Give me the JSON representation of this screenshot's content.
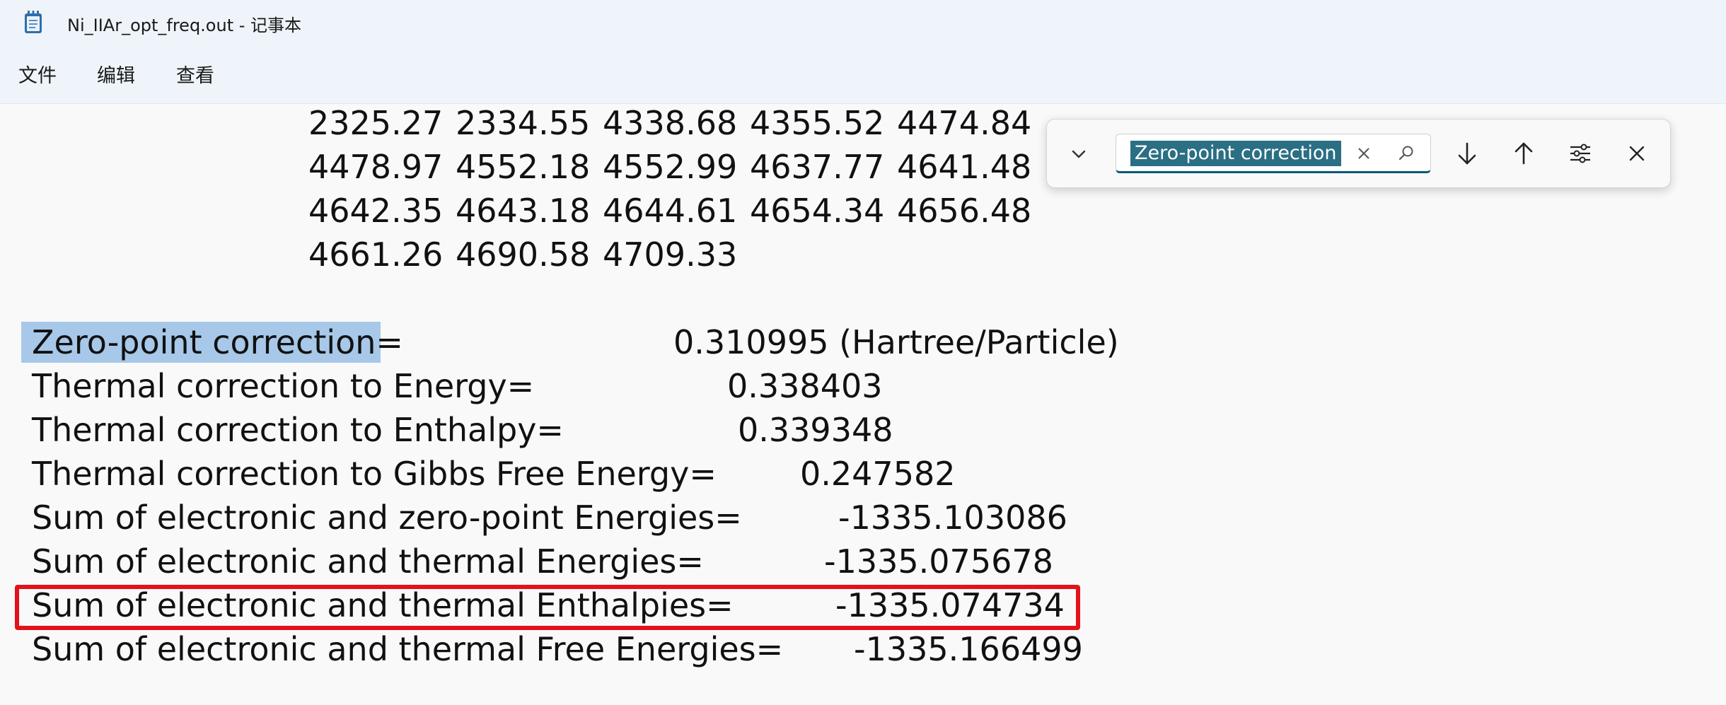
{
  "window": {
    "title": "Ni_IIAr_opt_freq.out - 记事本"
  },
  "menu": {
    "file": "文件",
    "edit": "编辑",
    "view": "查看"
  },
  "find": {
    "query": "Zero-point correction"
  },
  "frequencies": [
    [
      "2325.27",
      "2334.55",
      "4338.68",
      "4355.52",
      "4474.84"
    ],
    [
      "4478.97",
      "4552.18",
      "4552.99",
      "4637.77",
      "4641.48"
    ],
    [
      "4642.35",
      "4643.18",
      "4644.61",
      "4654.34",
      "4656.48"
    ],
    [
      "4661.26",
      "4690.58",
      "4709.33"
    ]
  ],
  "thermo": {
    "zpe": {
      "label": "Zero-point correction",
      "eq": "=",
      "value": "0.310995 (Hartree/Particle)"
    },
    "energy": {
      "label": "Thermal correction to Energy=",
      "value": "0.338403"
    },
    "enthalpy": {
      "label": "Thermal correction to Enthalpy=",
      "value": "0.339348"
    },
    "gibbs": {
      "label": "Thermal correction to Gibbs Free Energy=",
      "value": "0.247582"
    },
    "sum_zpe": {
      "label": "Sum of electronic and zero-point Energies=",
      "value": "-1335.103086"
    },
    "sum_thermal": {
      "label": "Sum of electronic and thermal Energies=",
      "value": "-1335.075678"
    },
    "sum_enthalpies": {
      "label": "Sum of electronic and thermal Enthalpies=",
      "value": "-1335.074734"
    },
    "sum_free": {
      "label": "Sum of electronic and thermal Free Energies=",
      "value": "-1335.166499"
    }
  },
  "colors": {
    "highlight": "#a7c8e8",
    "annotation_box": "#e3111a",
    "find_selection": "#2b6f84"
  }
}
